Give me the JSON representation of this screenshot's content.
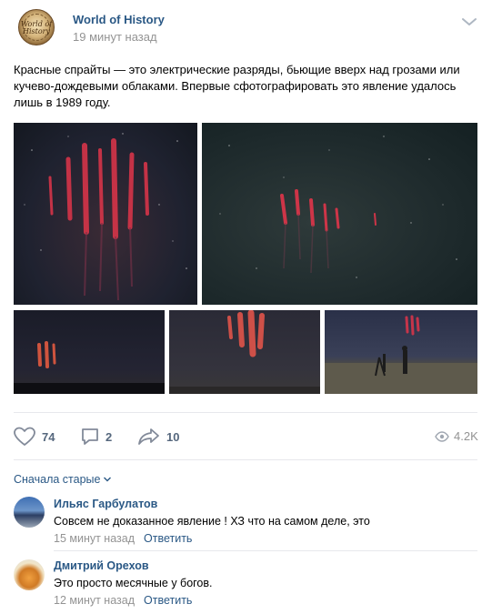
{
  "post": {
    "group_name": "World of History",
    "time": "19 минут назад",
    "text": "Красные спрайты — это электрические разряды, бьющие вверх над грозами или кучево-дождевыми облаками. Впервые сфотографировать это явление удалось лишь в 1989 году.",
    "avatar_icon": "world-of-history-logo",
    "avatar_mark": "World of History",
    "menu_icon": "chevron-down-icon",
    "photos": [
      {
        "subject": "red sprites over night sky"
      },
      {
        "subject": "red sprites jellyfish over starry sky"
      },
      {
        "subject": "red sprite above dark horizon"
      },
      {
        "subject": "red sprite column in cloudy sky"
      },
      {
        "subject": "red sprite above observers with tripod"
      }
    ]
  },
  "actions": {
    "likes": "74",
    "comments": "2",
    "shares": "10",
    "views": "4.2K"
  },
  "comments_sort": "Сначала старые",
  "comments": [
    {
      "author": "Ильяс Гарбулатов",
      "text": "Совсем не доказанное явление ! ХЗ что на самом деле, это",
      "time": "15 минут назад",
      "reply_label": "Ответить"
    },
    {
      "author": "Дмитрий Орехов",
      "text": "Это просто месячные у богов.",
      "time": "12 минут назад",
      "reply_label": "Ответить"
    }
  ],
  "colors": {
    "link": "#2a5885",
    "muted": "#939393",
    "icon": "#828a99",
    "sprite_red": "#e0354a"
  }
}
